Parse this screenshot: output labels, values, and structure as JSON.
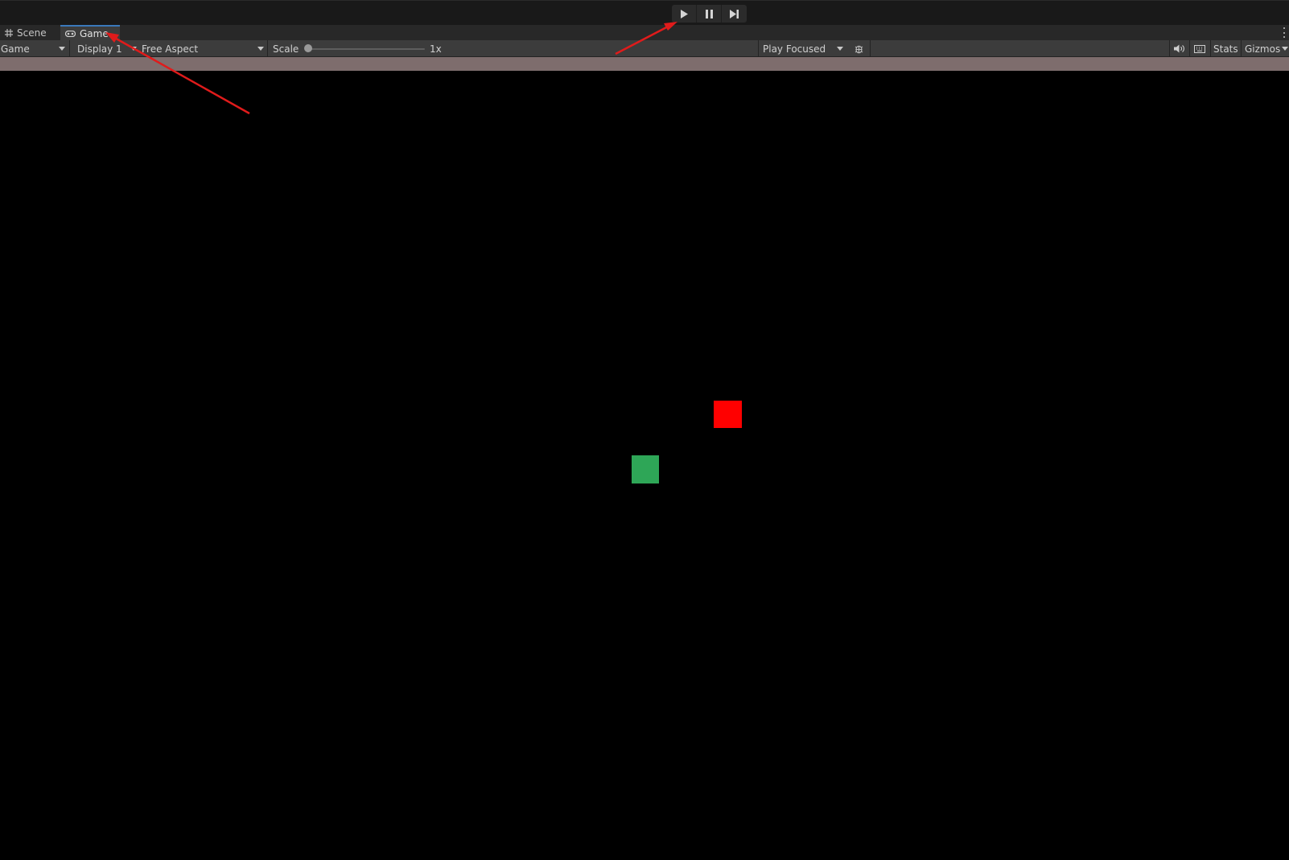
{
  "play_toolbar": {
    "buttons": [
      {
        "name": "play-button",
        "icon": "play-icon"
      },
      {
        "name": "pause-button",
        "icon": "pause-icon"
      },
      {
        "name": "step-button",
        "icon": "step-forward-icon"
      }
    ]
  },
  "tabs": [
    {
      "label": "Scene",
      "icon": "scene-grid-icon",
      "active": false
    },
    {
      "label": "Game",
      "icon": "gamepad-icon",
      "active": true
    }
  ],
  "game_toolbar": {
    "view_mode": "Game",
    "display": "Display 1",
    "aspect": "Free Aspect",
    "scale_label": "Scale",
    "scale_value": "1x",
    "play_mode": "Play Focused",
    "stats_label": "Stats",
    "gizmos_label": "Gizmos",
    "icons": [
      "bug-icon",
      "speaker-icon",
      "keyboard-icon",
      "chevron-down-icon"
    ]
  },
  "game_view": {
    "sprites": [
      {
        "name": "red-square",
        "color": "#ff0000"
      },
      {
        "name": "green-square",
        "color": "#2ea657"
      }
    ]
  },
  "annotations": {
    "arrow_color": "#e01b1b",
    "arrows": [
      "arrow-to-game-tab",
      "arrow-to-play-button"
    ]
  },
  "colors": {
    "tab_accent": "#3a79bb",
    "tint_strip": "#7e6d6d",
    "toolbar_bg": "#3c3c3c"
  }
}
